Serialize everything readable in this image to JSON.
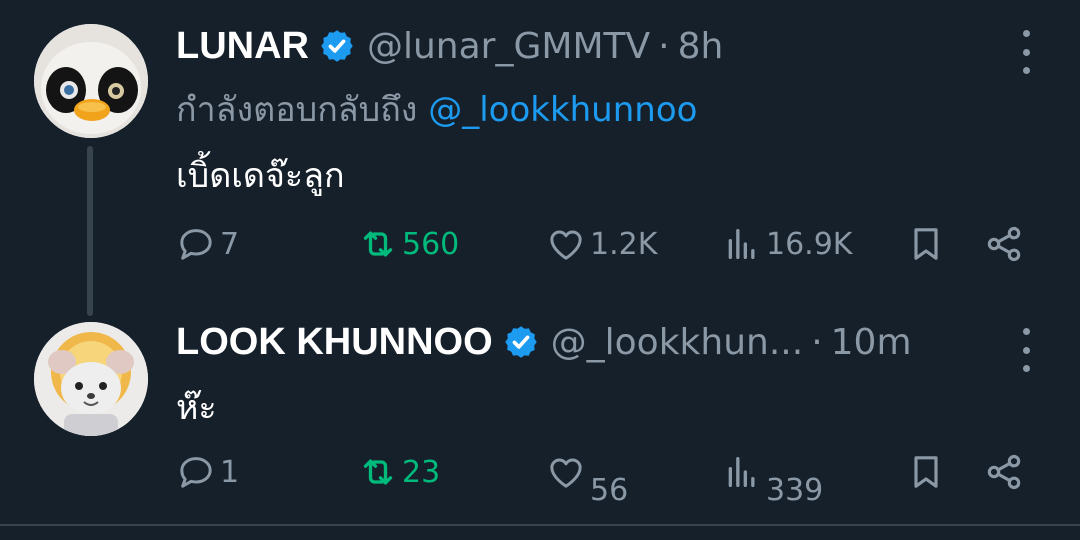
{
  "colors": {
    "background": "#15202b",
    "accent": "#1d9bf0",
    "repost_active": "#00ba7c",
    "muted": "#8b98a5"
  },
  "tweets": [
    {
      "avatar_icon": "penguin-duck-plush-avatar",
      "display_name": "LUNAR",
      "verified_icon": "verified-badge-icon",
      "handle": "@lunar_GMMTV",
      "separator": "·",
      "time": "8h",
      "reply_prefix": "กำลังตอบกลับถึง",
      "reply_mention": "@_lookkhunnoo",
      "text": "เบิ้ดเดจ๊ะลูก",
      "stats": {
        "replies": "7",
        "reposts": "560",
        "likes": "1.2K",
        "views": "16.9K"
      },
      "reposted": true
    },
    {
      "avatar_icon": "lion-mouse-plush-avatar",
      "display_name": "LOOK KHUNNOO",
      "verified_icon": "verified-badge-icon",
      "handle": "@_lookkhun...",
      "separator": "·",
      "time": "10m",
      "text": "ห๊ะ",
      "stats": {
        "replies": "1",
        "reposts": "23",
        "likes": "56",
        "views": "339"
      },
      "reposted": true
    }
  ]
}
